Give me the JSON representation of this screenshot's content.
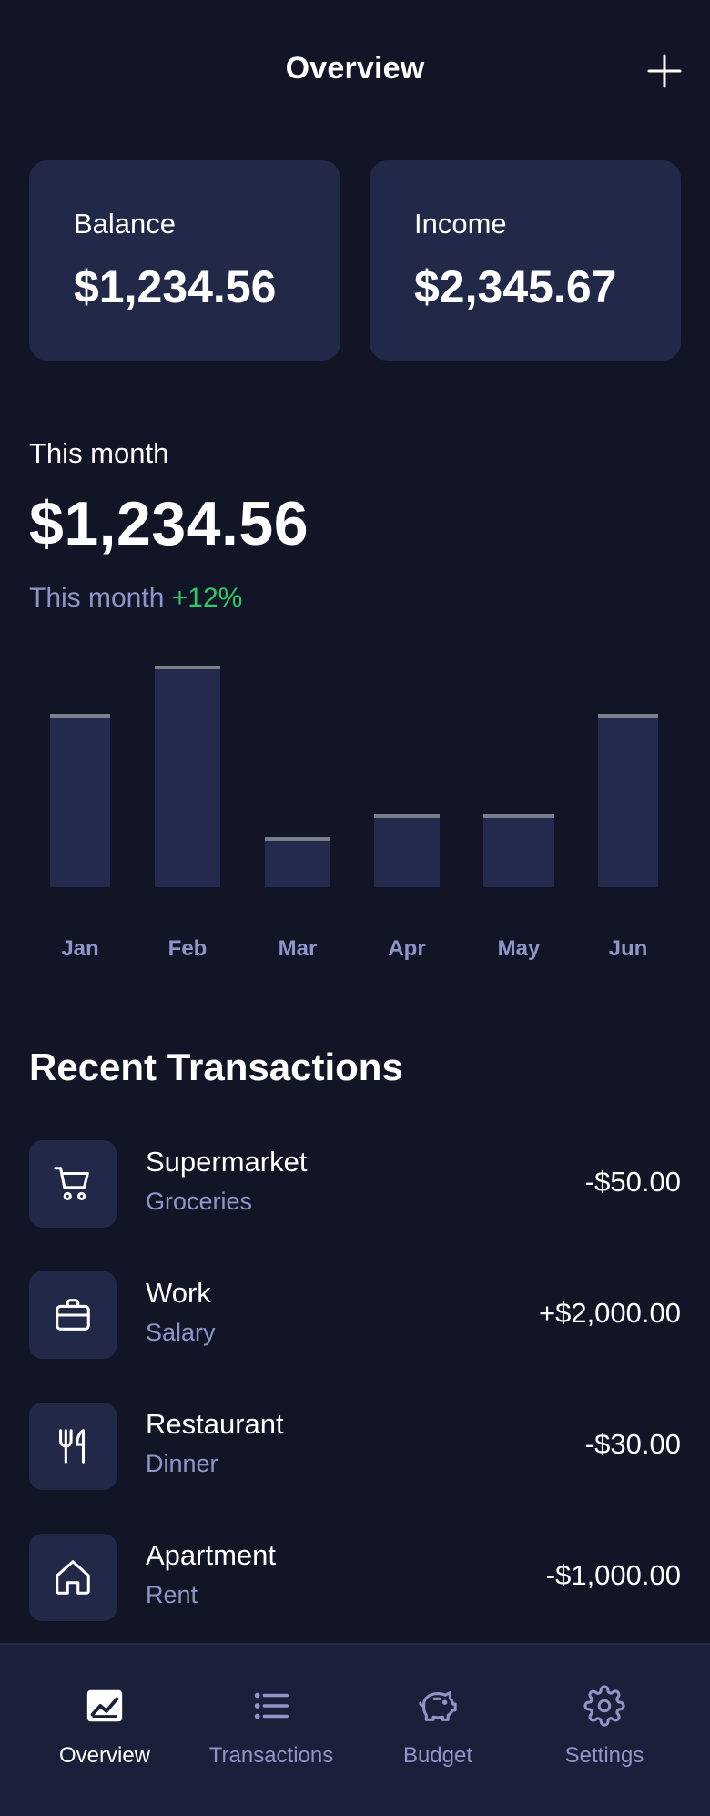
{
  "header": {
    "title": "Overview"
  },
  "cards": {
    "balance": {
      "label": "Balance",
      "value": "$1,234.56"
    },
    "income": {
      "label": "Income",
      "value": "$2,345.67"
    }
  },
  "summary": {
    "label": "This month",
    "amount": "$1,234.56",
    "change_prefix": "This month",
    "change_pct": "+12%"
  },
  "chart_data": {
    "type": "bar",
    "categories": [
      "Jan",
      "Feb",
      "Mar",
      "Apr",
      "May",
      "Jun"
    ],
    "values": [
      190,
      243,
      55,
      80,
      80,
      190
    ],
    "ylim": [
      0,
      250
    ],
    "grid": false,
    "bar_color": "#232a4d",
    "cap_color": "#7a7d8a",
    "label_color": "#8f95c7"
  },
  "transactions": {
    "title": "Recent Transactions",
    "items": [
      {
        "name": "Supermarket",
        "category": "Groceries",
        "amount": "-$50.00",
        "icon": "cart-icon"
      },
      {
        "name": "Work",
        "category": "Salary",
        "amount": "+$2,000.00",
        "icon": "briefcase-icon"
      },
      {
        "name": "Restaurant",
        "category": "Dinner",
        "amount": "-$30.00",
        "icon": "utensils-icon"
      },
      {
        "name": "Apartment",
        "category": "Rent",
        "amount": "-$1,000.00",
        "icon": "home-icon"
      }
    ]
  },
  "nav": {
    "items": [
      {
        "label": "Overview",
        "icon": "chart-icon",
        "active": true
      },
      {
        "label": "Transactions",
        "icon": "list-icon",
        "active": false
      },
      {
        "label": "Budget",
        "icon": "piggy-bank-icon",
        "active": false
      },
      {
        "label": "Settings",
        "icon": "gear-icon",
        "active": false
      }
    ]
  },
  "colors": {
    "background": "#111526",
    "card": "#222847",
    "muted": "#8f95c7",
    "positive": "#2ec868"
  }
}
